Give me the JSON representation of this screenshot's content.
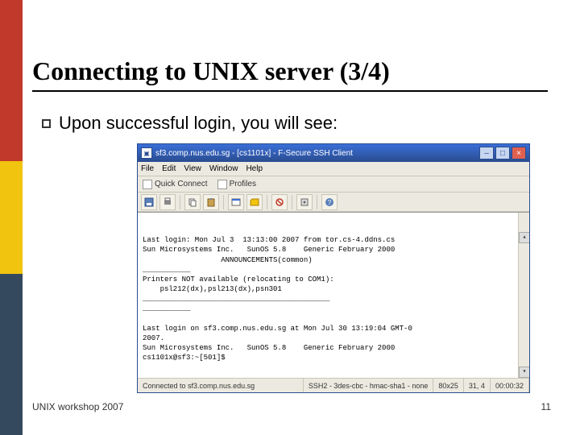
{
  "slide": {
    "title": "Connecting to UNIX server (3/4)",
    "bullet": "Upon successful login, you will see:",
    "footer_left": "UNIX workshop 2007",
    "footer_right": "11"
  },
  "window": {
    "title": "sf3.comp.nus.edu.sg - [cs1101x] - F-Secure SSH Client",
    "min_label": "–",
    "max_label": "□",
    "close_label": "×",
    "menu": {
      "file": "File",
      "edit": "Edit",
      "view": "View",
      "window": "Window",
      "help": "Help"
    },
    "quick": {
      "connect": "Quick Connect",
      "profiles": "Profiles"
    },
    "statusbar": {
      "host": "Connected to sf3.comp.nus.edu.sg",
      "proto": "SSH2 - 3des-cbc - hmac-sha1 - none",
      "size": "80x25",
      "pos": "31, 4",
      "time": "00:00:32"
    }
  },
  "terminal": {
    "lines": [
      "Last login: Mon Jul 3  13:13:00 2007 from tor.cs-4.ddns.cs",
      "Sun Microsystems Inc.   SunOS 5.8    Generic February 2000",
      "                  ANNOUNCEMENTS(common)",
      "___________",
      "Printers NOT available (relocating to COM1):",
      "    psl212(dx),psl213(dx),psn301",
      "___________________________________________",
      "___________",
      "",
      "Last login on sf3.comp.nus.edu.sg at Mon Jul 30 13:19:04 GMT-0",
      "2007.",
      "Sun Microsystems Inc.   SunOS 5.8    Generic February 2000",
      "cs1101x@sf3:~[501]$"
    ]
  }
}
